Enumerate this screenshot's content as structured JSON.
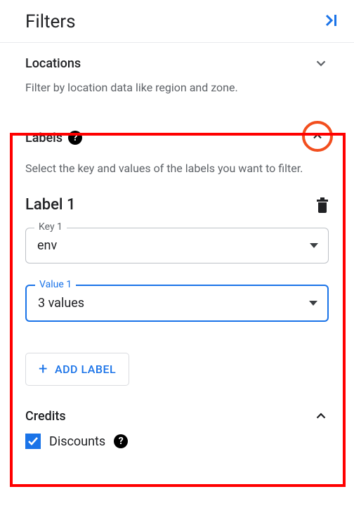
{
  "header": {
    "title": "Filters"
  },
  "sections": {
    "locations": {
      "title": "Locations",
      "desc": "Filter by location data like region and zone."
    },
    "labels": {
      "title": "Labels",
      "desc": "Select the key and values of the labels you want to filter.",
      "blocks": [
        {
          "title": "Label 1",
          "key_label": "Key 1",
          "key_value": "env",
          "value_label": "Value 1",
          "value_value": "3 values"
        }
      ],
      "add_button": "ADD LABEL"
    },
    "credits": {
      "title": "Credits",
      "items": [
        {
          "label": "Discounts",
          "checked": true
        }
      ]
    }
  }
}
